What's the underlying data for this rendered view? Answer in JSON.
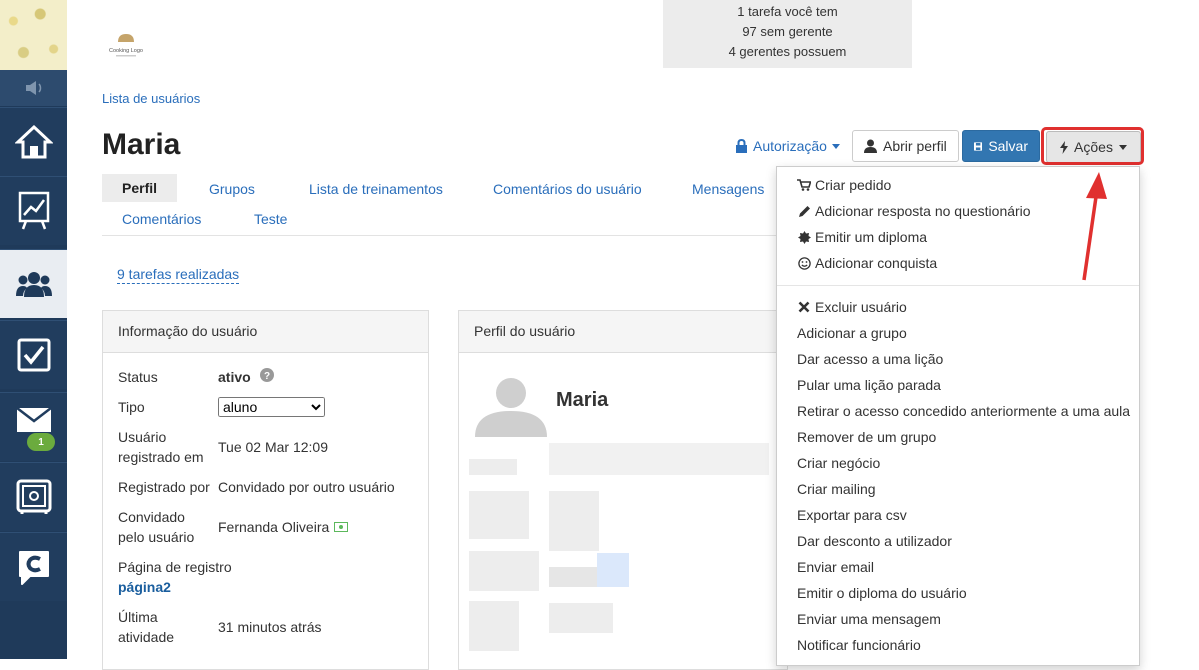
{
  "stats": {
    "line1": "1 tarefa você tem",
    "line2": "97 sem gerente",
    "line3": "4 gerentes possuem"
  },
  "company_logo_text": "Cooking Logo",
  "sidebar": {
    "mail_badge": "1",
    "items": [
      "home-icon",
      "chart-icon",
      "users-icon",
      "checkbox-icon",
      "mail-icon",
      "safe-icon",
      "chat-icon"
    ]
  },
  "breadcrumb": "Lista de usuários",
  "page_title": "Maria",
  "toolbar": {
    "authorization": "Autorização",
    "open_profile": "Abrir perfil",
    "save": "Salvar",
    "actions": "Ações"
  },
  "tabs": [
    {
      "label": "Perfil",
      "active": true
    },
    {
      "label": "Grupos"
    },
    {
      "label": "Lista de treinamentos"
    },
    {
      "label": "Comentários do usuário"
    },
    {
      "label": "Mensagens"
    },
    {
      "label": "Comentários"
    },
    {
      "label": "Teste"
    }
  ],
  "tasks_done": "9 tarefas realizadas",
  "info_panel": {
    "title": "Informação do usuário",
    "status_label": "Status",
    "status_value": "ativo",
    "type_label": "Tipo",
    "type_value": "aluno",
    "registered_label_1": "Usuário",
    "registered_label_2": "registrado em",
    "registered_value": "Tue 02 Mar 12:09",
    "registered_by_label": "Registrado por",
    "registered_by_value": "Convidado por outro usuário",
    "invited_label_1": "Convidado",
    "invited_label_2": "pelo usuário",
    "invited_value": "Fernanda Oliveira",
    "reg_page_label": "Página de registro",
    "reg_page_value": "página2",
    "last_activity_label_1": "Última",
    "last_activity_label_2": "atividade",
    "last_activity_value": "31 minutos atrás"
  },
  "profile_panel": {
    "title": "Perfil do usuário",
    "name": "Maria"
  },
  "actions_menu": {
    "group1": [
      {
        "label": "Criar pedido",
        "icon": "cart-icon"
      },
      {
        "label": "Adicionar resposta no questionário",
        "icon": "pencil-icon"
      },
      {
        "label": "Emitir um diploma",
        "icon": "certificate-icon"
      },
      {
        "label": "Adicionar conquista",
        "icon": "smile-icon"
      }
    ],
    "group2": [
      {
        "label": "Excluir usuário",
        "icon": "close-icon"
      },
      {
        "label": "Adicionar a grupo"
      },
      {
        "label": "Dar acesso a uma lição"
      },
      {
        "label": "Pular uma lição parada"
      },
      {
        "label": "Retirar o acesso concedido anteriormente a uma aula"
      },
      {
        "label": "Remover de um grupo"
      },
      {
        "label": "Criar negócio"
      },
      {
        "label": "Criar mailing"
      },
      {
        "label": "Exportar para csv"
      },
      {
        "label": "Dar desconto a utilizador"
      },
      {
        "label": "Enviar email"
      },
      {
        "label": "Emitir o diploma do usuário"
      },
      {
        "label": "Enviar uma mensagem"
      },
      {
        "label": "Notificar funcionário"
      }
    ]
  },
  "colors": {
    "sidebar": "#1f3a5a",
    "link": "#2a6ebb",
    "save_button": "#3276b1",
    "highlight": "#e0302f",
    "badge": "#6bab3e"
  }
}
